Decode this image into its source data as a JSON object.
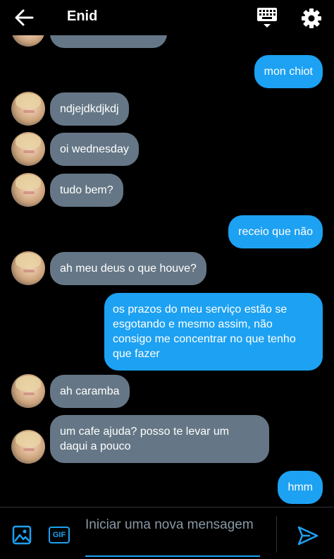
{
  "header": {
    "title": "Enid",
    "back_icon": "arrow-left-icon",
    "keyboard_icon": "keyboard-icon",
    "settings_icon": "gear-icon"
  },
  "messages": [
    {
      "side": "out",
      "text": "mon chiot"
    },
    {
      "side": "in",
      "text": "ndjejdkdjkdj"
    },
    {
      "side": "in",
      "text": "oi wednesday"
    },
    {
      "side": "in",
      "text": "tudo bem?"
    },
    {
      "side": "out",
      "text": "receio que não"
    },
    {
      "side": "in",
      "text": "ah meu deus o que houve?"
    },
    {
      "side": "out",
      "text": "os prazos do meu serviço estão se esgotando e mesmo assim, não consigo me concentrar no que tenho que fazer"
    },
    {
      "side": "in",
      "text": "ah caramba"
    },
    {
      "side": "in",
      "text": "um cafe ajuda? posso te levar um daqui a pouco"
    },
    {
      "side": "out",
      "text": "hmm"
    }
  ],
  "composer": {
    "placeholder": "Iniciar uma nova mensagem",
    "gif_label": "GIF",
    "image_icon": "image-icon",
    "send_icon": "send-icon"
  },
  "colors": {
    "background": "#000000",
    "outgoing_bubble": "#1da1f2",
    "incoming_bubble": "#657786",
    "accent": "#1da1f2"
  }
}
